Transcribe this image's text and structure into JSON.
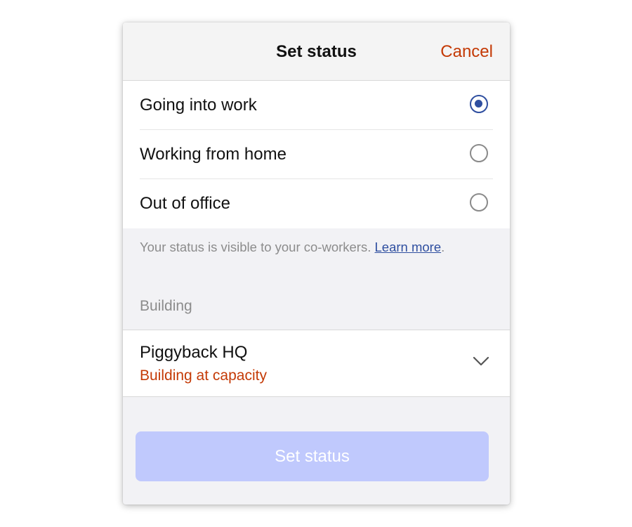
{
  "dialog": {
    "title": "Set status",
    "cancel_label": "Cancel"
  },
  "status_options": [
    {
      "label": "Going into work",
      "selected": true
    },
    {
      "label": "Working from home",
      "selected": false
    },
    {
      "label": "Out of office",
      "selected": false
    }
  ],
  "helper": {
    "text": "Your status is visible to your co-workers. ",
    "link_label": "Learn more",
    "suffix": "."
  },
  "building_section": {
    "label": "Building",
    "selected_building": "Piggyback HQ",
    "capacity_status": "Building at capacity",
    "icon": "chevron-down-icon"
  },
  "submit": {
    "label": "Set status",
    "disabled": true
  },
  "colors": {
    "accent": "#2f4fa0",
    "warning": "#c43a06",
    "button_disabled": "#c0c9fd"
  }
}
